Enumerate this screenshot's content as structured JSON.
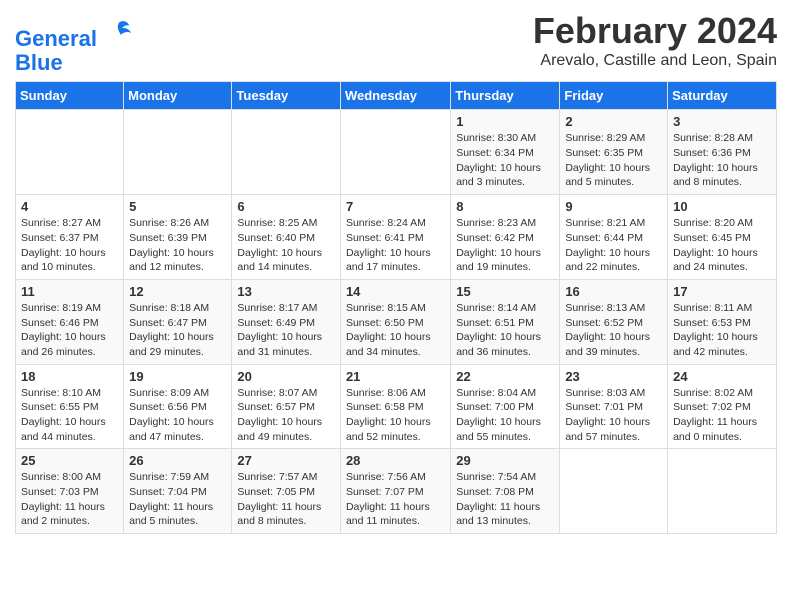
{
  "logo": {
    "line1": "General",
    "line2": "Blue"
  },
  "title": "February 2024",
  "location": "Arevalo, Castille and Leon, Spain",
  "days_of_week": [
    "Sunday",
    "Monday",
    "Tuesday",
    "Wednesday",
    "Thursday",
    "Friday",
    "Saturday"
  ],
  "weeks": [
    [
      {
        "day": "",
        "info": ""
      },
      {
        "day": "",
        "info": ""
      },
      {
        "day": "",
        "info": ""
      },
      {
        "day": "",
        "info": ""
      },
      {
        "day": "1",
        "info": "Sunrise: 8:30 AM\nSunset: 6:34 PM\nDaylight: 10 hours\nand 3 minutes."
      },
      {
        "day": "2",
        "info": "Sunrise: 8:29 AM\nSunset: 6:35 PM\nDaylight: 10 hours\nand 5 minutes."
      },
      {
        "day": "3",
        "info": "Sunrise: 8:28 AM\nSunset: 6:36 PM\nDaylight: 10 hours\nand 8 minutes."
      }
    ],
    [
      {
        "day": "4",
        "info": "Sunrise: 8:27 AM\nSunset: 6:37 PM\nDaylight: 10 hours\nand 10 minutes."
      },
      {
        "day": "5",
        "info": "Sunrise: 8:26 AM\nSunset: 6:39 PM\nDaylight: 10 hours\nand 12 minutes."
      },
      {
        "day": "6",
        "info": "Sunrise: 8:25 AM\nSunset: 6:40 PM\nDaylight: 10 hours\nand 14 minutes."
      },
      {
        "day": "7",
        "info": "Sunrise: 8:24 AM\nSunset: 6:41 PM\nDaylight: 10 hours\nand 17 minutes."
      },
      {
        "day": "8",
        "info": "Sunrise: 8:23 AM\nSunset: 6:42 PM\nDaylight: 10 hours\nand 19 minutes."
      },
      {
        "day": "9",
        "info": "Sunrise: 8:21 AM\nSunset: 6:44 PM\nDaylight: 10 hours\nand 22 minutes."
      },
      {
        "day": "10",
        "info": "Sunrise: 8:20 AM\nSunset: 6:45 PM\nDaylight: 10 hours\nand 24 minutes."
      }
    ],
    [
      {
        "day": "11",
        "info": "Sunrise: 8:19 AM\nSunset: 6:46 PM\nDaylight: 10 hours\nand 26 minutes."
      },
      {
        "day": "12",
        "info": "Sunrise: 8:18 AM\nSunset: 6:47 PM\nDaylight: 10 hours\nand 29 minutes."
      },
      {
        "day": "13",
        "info": "Sunrise: 8:17 AM\nSunset: 6:49 PM\nDaylight: 10 hours\nand 31 minutes."
      },
      {
        "day": "14",
        "info": "Sunrise: 8:15 AM\nSunset: 6:50 PM\nDaylight: 10 hours\nand 34 minutes."
      },
      {
        "day": "15",
        "info": "Sunrise: 8:14 AM\nSunset: 6:51 PM\nDaylight: 10 hours\nand 36 minutes."
      },
      {
        "day": "16",
        "info": "Sunrise: 8:13 AM\nSunset: 6:52 PM\nDaylight: 10 hours\nand 39 minutes."
      },
      {
        "day": "17",
        "info": "Sunrise: 8:11 AM\nSunset: 6:53 PM\nDaylight: 10 hours\nand 42 minutes."
      }
    ],
    [
      {
        "day": "18",
        "info": "Sunrise: 8:10 AM\nSunset: 6:55 PM\nDaylight: 10 hours\nand 44 minutes."
      },
      {
        "day": "19",
        "info": "Sunrise: 8:09 AM\nSunset: 6:56 PM\nDaylight: 10 hours\nand 47 minutes."
      },
      {
        "day": "20",
        "info": "Sunrise: 8:07 AM\nSunset: 6:57 PM\nDaylight: 10 hours\nand 49 minutes."
      },
      {
        "day": "21",
        "info": "Sunrise: 8:06 AM\nSunset: 6:58 PM\nDaylight: 10 hours\nand 52 minutes."
      },
      {
        "day": "22",
        "info": "Sunrise: 8:04 AM\nSunset: 7:00 PM\nDaylight: 10 hours\nand 55 minutes."
      },
      {
        "day": "23",
        "info": "Sunrise: 8:03 AM\nSunset: 7:01 PM\nDaylight: 10 hours\nand 57 minutes."
      },
      {
        "day": "24",
        "info": "Sunrise: 8:02 AM\nSunset: 7:02 PM\nDaylight: 11 hours\nand 0 minutes."
      }
    ],
    [
      {
        "day": "25",
        "info": "Sunrise: 8:00 AM\nSunset: 7:03 PM\nDaylight: 11 hours\nand 2 minutes."
      },
      {
        "day": "26",
        "info": "Sunrise: 7:59 AM\nSunset: 7:04 PM\nDaylight: 11 hours\nand 5 minutes."
      },
      {
        "day": "27",
        "info": "Sunrise: 7:57 AM\nSunset: 7:05 PM\nDaylight: 11 hours\nand 8 minutes."
      },
      {
        "day": "28",
        "info": "Sunrise: 7:56 AM\nSunset: 7:07 PM\nDaylight: 11 hours\nand 11 minutes."
      },
      {
        "day": "29",
        "info": "Sunrise: 7:54 AM\nSunset: 7:08 PM\nDaylight: 11 hours\nand 13 minutes."
      },
      {
        "day": "",
        "info": ""
      },
      {
        "day": "",
        "info": ""
      }
    ]
  ]
}
